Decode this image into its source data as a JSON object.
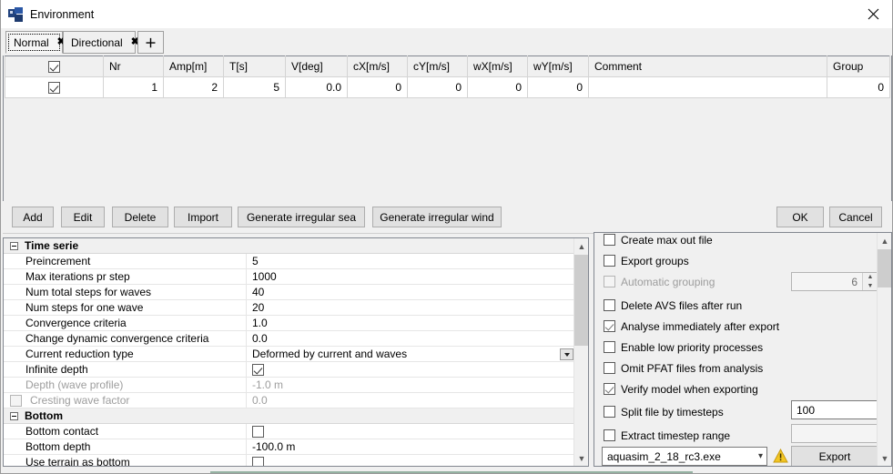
{
  "window": {
    "title": "Environment",
    "icon": "window-app-icon",
    "close_label": "✕"
  },
  "tabs": {
    "items": [
      {
        "label": "Normal",
        "close": "✖",
        "selected": true
      },
      {
        "label": "Directional",
        "close": "✖",
        "selected": false
      }
    ],
    "add_label": "＋"
  },
  "table": {
    "columns": [
      "",
      "Nr",
      "Amp[m]",
      "T[s]",
      "V[deg]",
      "cX[m/s]",
      "cY[m/s]",
      "wX[m/s]",
      "wY[m/s]",
      "Comment",
      "Group"
    ],
    "header_checkbox_checked": true,
    "rows": [
      {
        "checked": true,
        "Nr": "1",
        "Amp[m]": "2",
        "T[s]": "5",
        "V[deg]": "0.0",
        "cX[m/s]": "0",
        "cY[m/s]": "0",
        "wX[m/s]": "0",
        "wY[m/s]": "0",
        "Comment": "",
        "Group": "0"
      }
    ]
  },
  "toolbar": {
    "add": "Add",
    "edit": "Edit",
    "delete": "Delete",
    "import": "Import",
    "generate_irregular_sea": "Generate irregular sea",
    "generate_irregular_wind": "Generate irregular wind",
    "ok": "OK",
    "cancel": "Cancel"
  },
  "properties": {
    "groups": [
      {
        "name": "Time serie",
        "rows": [
          {
            "label": "Preincrement",
            "value": "5",
            "type": "text"
          },
          {
            "label": "Max iterations pr step",
            "value": "1000",
            "type": "text"
          },
          {
            "label": "Num total steps for waves",
            "value": "40",
            "type": "text"
          },
          {
            "label": "Num steps for one wave",
            "value": "20",
            "type": "text"
          },
          {
            "label": "Convergence criteria",
            "value": "1.0",
            "type": "text"
          },
          {
            "label": "Change dynamic convergence criteria",
            "value": "0.0",
            "type": "text"
          },
          {
            "label": "Current reduction type",
            "value": "Deformed by current and waves",
            "type": "combo"
          },
          {
            "label": "Infinite depth",
            "value": "",
            "type": "checkbox",
            "checked": true
          },
          {
            "label": "Depth (wave profile)",
            "value": "-1.0 m",
            "type": "text",
            "disabled": true
          },
          {
            "label": "Cresting wave factor",
            "value": "0.0",
            "type": "text",
            "disabled": true,
            "label_checkbox": true,
            "label_checked": false
          }
        ]
      },
      {
        "name": "Bottom",
        "rows": [
          {
            "label": "Bottom contact",
            "value": "",
            "type": "checkbox",
            "checked": false
          },
          {
            "label": "Bottom depth",
            "value": "-100.0 m",
            "type": "text"
          },
          {
            "label": "Use terrain as bottom",
            "value": "",
            "type": "checkbox",
            "checked": false
          }
        ]
      }
    ]
  },
  "options": {
    "items": [
      {
        "label": "Create max out file",
        "checked": false,
        "disabled": false
      },
      {
        "label": "Export groups",
        "checked": false,
        "disabled": false
      },
      {
        "label": "Automatic grouping",
        "checked": false,
        "disabled": true
      },
      {
        "label": "Delete AVS files after run",
        "checked": false,
        "disabled": false
      },
      {
        "label": "Analyse immediately after export",
        "checked": true,
        "disabled": false
      },
      {
        "label": "Enable low priority processes",
        "checked": false,
        "disabled": false
      },
      {
        "label": "Omit PFAT files from analysis",
        "checked": false,
        "disabled": false
      },
      {
        "label": "Verify model when exporting",
        "checked": true,
        "disabled": false
      },
      {
        "label": "Split file by timesteps",
        "checked": false,
        "disabled": false
      },
      {
        "label": "Extract timestep range",
        "checked": false,
        "disabled": false
      }
    ],
    "automatic_grouping_value": "6",
    "split_file_value": "100",
    "extract_range_value": "",
    "executable": "aquasim_2_18_rc3.exe",
    "export_button": "Export",
    "warning_icon": "warning-triangle-icon"
  },
  "colors": {
    "window_bg": "#f0f0f0",
    "panel_border": "#828790",
    "button_face": "#e1e1e1",
    "warning": "#f0c419",
    "accent": "#4a7f63"
  }
}
